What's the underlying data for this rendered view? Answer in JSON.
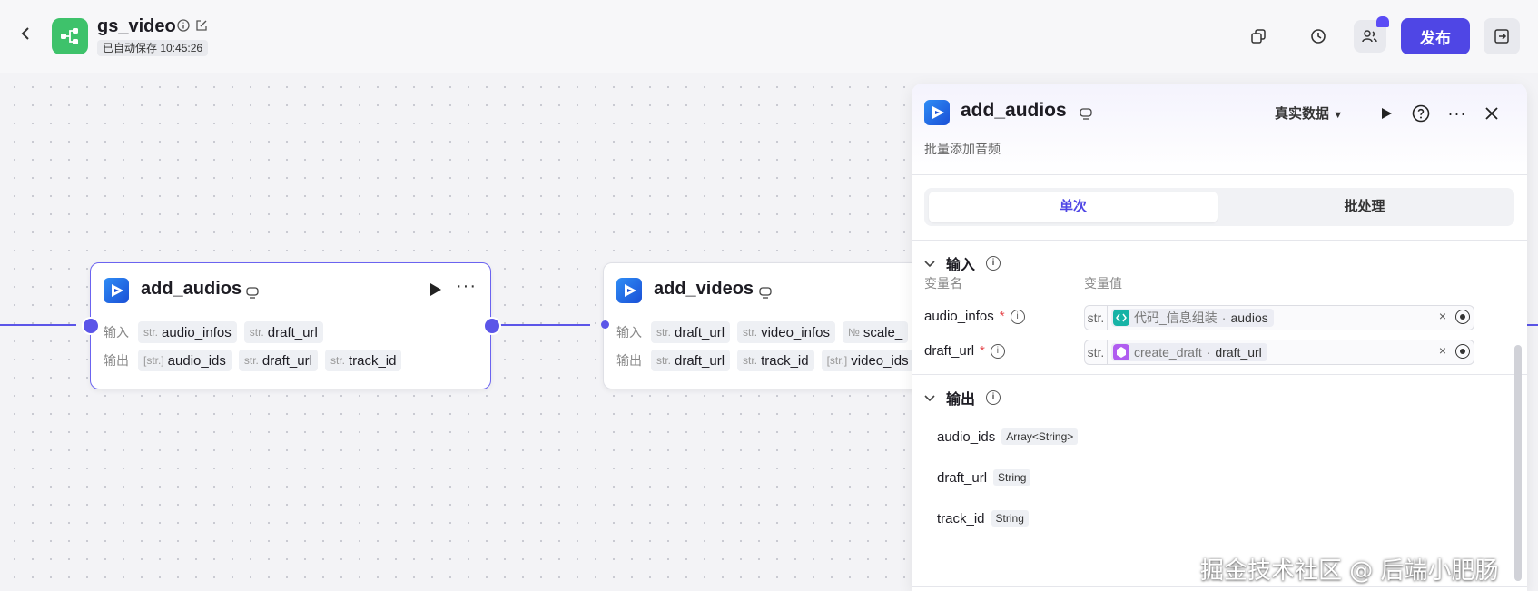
{
  "header": {
    "app_name": "gs_video",
    "autosave": "已自动保存 10:45:26",
    "publish_label": "发布",
    "icons": [
      "back-icon",
      "info-icon",
      "edit-icon",
      "copy-icon",
      "history-icon",
      "collaborators-icon",
      "exit-icon"
    ]
  },
  "nodes": [
    {
      "title": "add_audios",
      "input_label": "输入",
      "output_label": "输出",
      "inputs": [
        {
          "type": "str.",
          "name": "audio_infos"
        },
        {
          "type": "str.",
          "name": "draft_url"
        }
      ],
      "outputs": [
        {
          "type": "[str.]",
          "name": "audio_ids"
        },
        {
          "type": "str.",
          "name": "draft_url"
        },
        {
          "type": "str.",
          "name": "track_id"
        }
      ]
    },
    {
      "title": "add_videos",
      "input_label": "输入",
      "output_label": "输出",
      "inputs": [
        {
          "type": "str.",
          "name": "draft_url"
        },
        {
          "type": "str.",
          "name": "video_infos"
        },
        {
          "type": "№",
          "name": "scale_"
        }
      ],
      "outputs": [
        {
          "type": "str.",
          "name": "draft_url"
        },
        {
          "type": "str.",
          "name": "track_id"
        },
        {
          "type": "[str.]",
          "name": "video_ids"
        }
      ]
    }
  ],
  "panel": {
    "title": "add_audios",
    "description": "批量添加音频",
    "data_select": "真实数据",
    "tabs": {
      "single": "单次",
      "batch": "批处理"
    },
    "input_section": "输入",
    "col_name": "变量名",
    "col_value": "变量值",
    "params": [
      {
        "name": "audio_infos",
        "type": "str.",
        "ref_node": "代码_信息组装",
        "ref_var": "audios",
        "color": "#16b3a6"
      },
      {
        "name": "draft_url",
        "type": "str.",
        "ref_node": "create_draft",
        "ref_var": "draft_url",
        "color": "#b05cf0"
      }
    ],
    "output_section": "输出",
    "outputs": [
      {
        "name": "audio_ids",
        "type": "Array<String>"
      },
      {
        "name": "draft_url",
        "type": "String"
      },
      {
        "name": "track_id",
        "type": "String"
      }
    ]
  },
  "watermark": "掘金技术社区 @ 后端小肥肠"
}
